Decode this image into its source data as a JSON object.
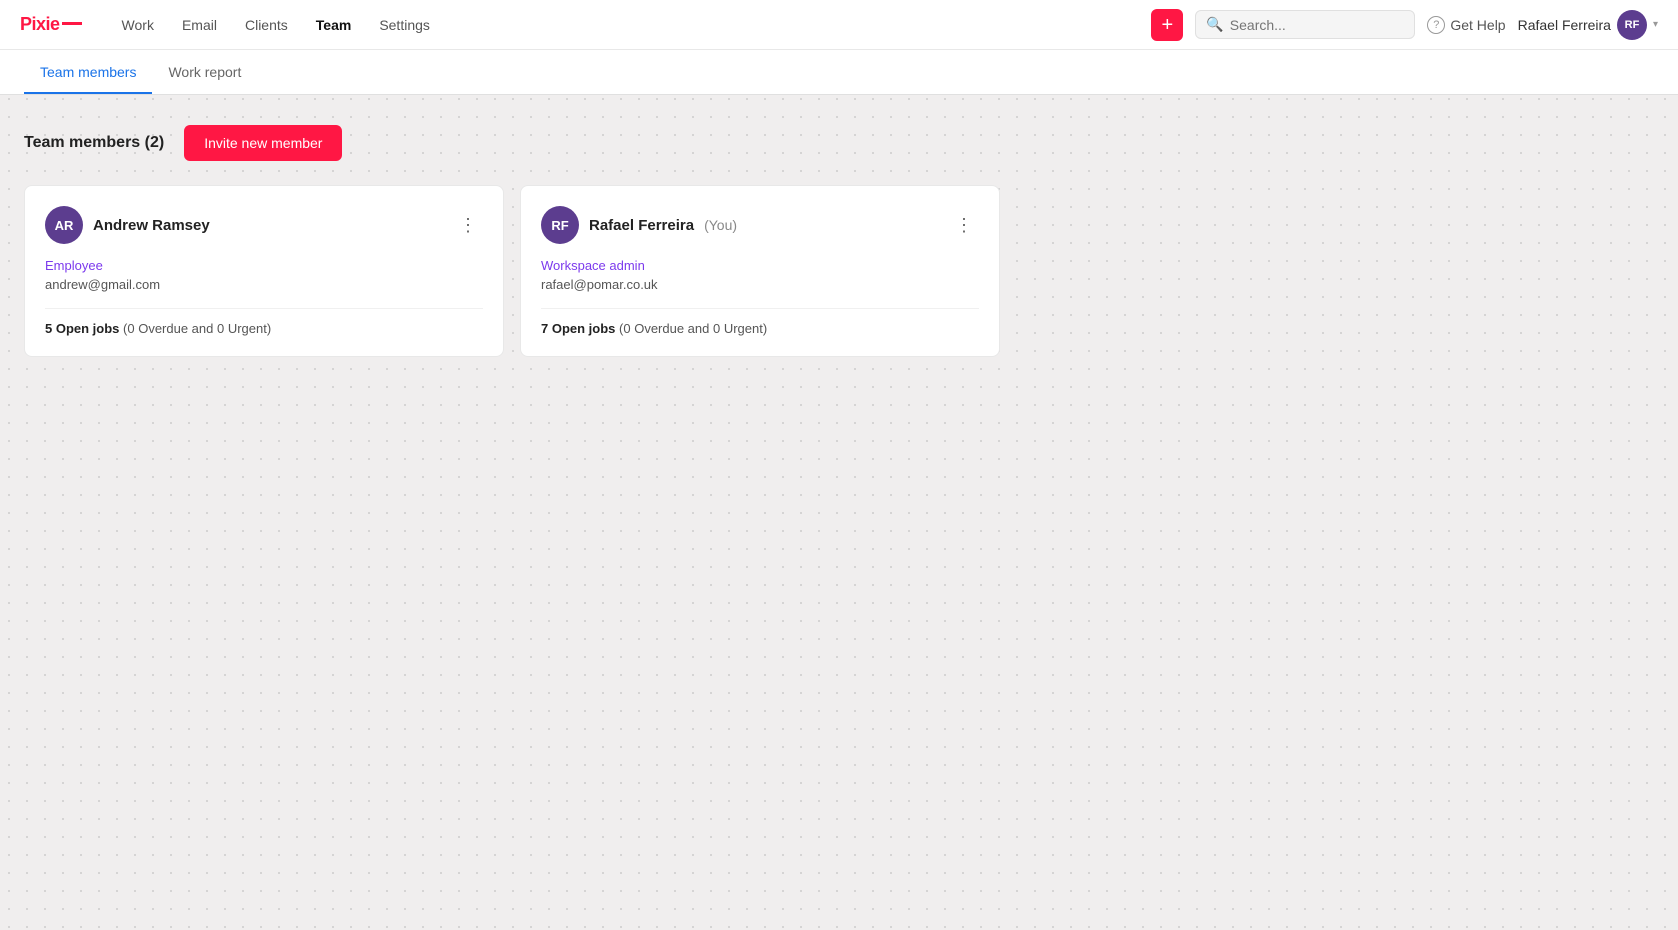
{
  "app": {
    "logo_text": "Pixie",
    "logo_dash": "—"
  },
  "nav": {
    "links": [
      {
        "label": "Work",
        "active": false
      },
      {
        "label": "Email",
        "active": false
      },
      {
        "label": "Clients",
        "active": false
      },
      {
        "label": "Team",
        "active": true
      },
      {
        "label": "Settings",
        "active": false
      }
    ],
    "add_button_icon": "+",
    "search_placeholder": "Search...",
    "help_label": "Get Help",
    "user_name": "Rafael Ferreira",
    "user_initials": "RF"
  },
  "subtabs": [
    {
      "label": "Team members",
      "active": true
    },
    {
      "label": "Work report",
      "active": false
    }
  ],
  "page": {
    "title": "Team members (2)",
    "invite_button": "Invite new member"
  },
  "members": [
    {
      "initials": "AR",
      "avatar_color": "#5c3d8f",
      "name": "Andrew Ramsey",
      "you_label": "",
      "role": "Employee",
      "email": "andrew@gmail.com",
      "jobs_text": "5 Open jobs",
      "jobs_detail": "(0 Overdue and 0 Urgent)"
    },
    {
      "initials": "RF",
      "avatar_color": "#5c3d8f",
      "name": "Rafael Ferreira",
      "you_label": "(You)",
      "role": "Workspace admin",
      "email": "rafael@pomar.co.uk",
      "jobs_text": "7 Open jobs",
      "jobs_detail": "(0 Overdue and 0 Urgent)"
    }
  ]
}
